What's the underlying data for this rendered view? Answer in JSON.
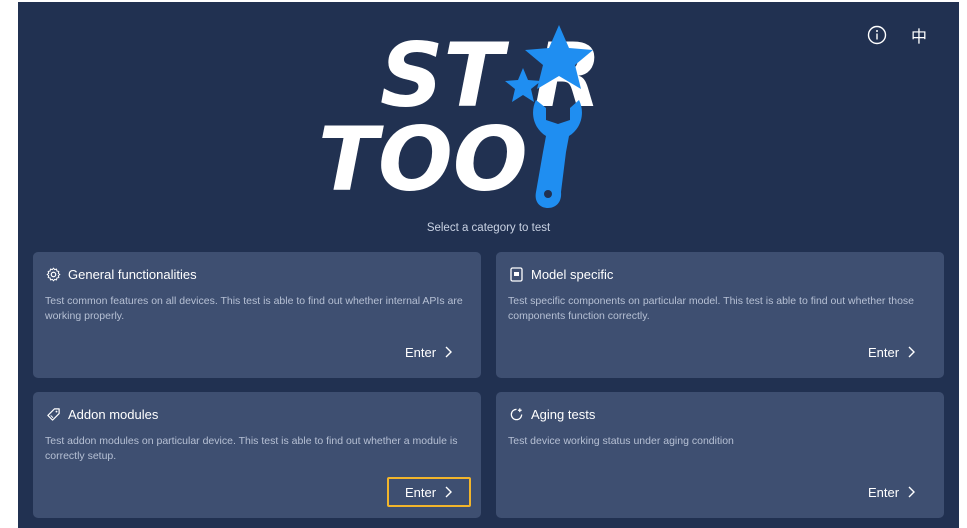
{
  "app": {
    "logo_line1": "ST  R",
    "logo_line2": "TOO",
    "logo_alt": "STAR TOOL",
    "subtitle": "Select a category to test",
    "language_label": "中",
    "colors": {
      "background": "#213151",
      "card": "#3e4f71",
      "accent": "#1f8ef1",
      "focus": "#f2b52b"
    }
  },
  "topbar": {
    "info_icon": "info-circle-icon",
    "language_label": "中"
  },
  "cards": [
    {
      "icon": "gear-icon",
      "title": "General functionalities",
      "description": "Test common features on all devices. This test is able to find out whether internal APIs are working properly.",
      "enter_label": "Enter"
    },
    {
      "icon": "device-icon",
      "title": "Model specific",
      "description": "Test specific components on particular model. This test is able to find out whether those components function correctly.",
      "enter_label": "Enter"
    },
    {
      "icon": "addon-tag-icon",
      "title": "Addon modules",
      "description": "Test addon modules on particular device. This test is able to find out whether a module is correctly setup.",
      "enter_label": "Enter",
      "focused": true
    },
    {
      "icon": "aging-clock-icon",
      "title": "Aging tests",
      "description": "Test device working status under aging condition",
      "enter_label": "Enter"
    }
  ]
}
